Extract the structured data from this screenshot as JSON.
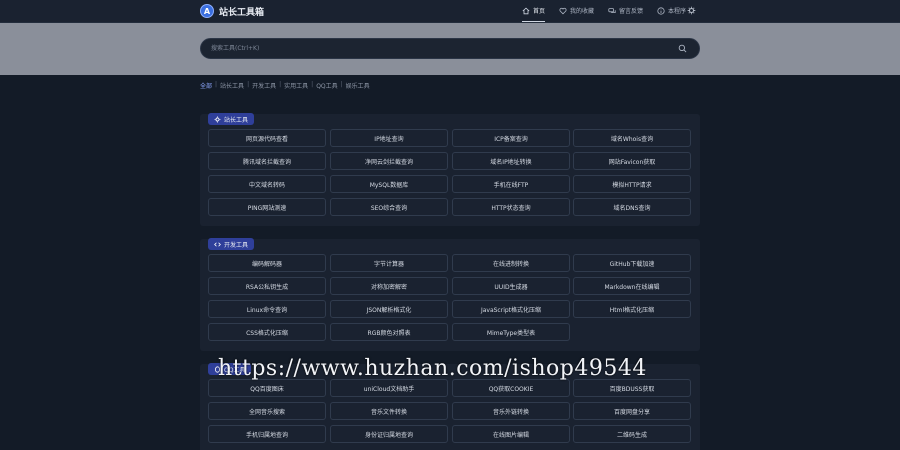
{
  "brand": {
    "name": "站长工具箱",
    "logo_letter": "A"
  },
  "nav": [
    {
      "label": "首页",
      "icon": "home-icon",
      "active": true
    },
    {
      "label": "我的收藏",
      "icon": "heart-icon",
      "active": false
    },
    {
      "label": "留言反馈",
      "icon": "chat-icon",
      "active": false
    },
    {
      "label": "本程序",
      "icon": "info-icon",
      "active": false
    }
  ],
  "search": {
    "placeholder": "搜索工具(Ctrl+K)"
  },
  "breadcrumb": [
    "全部",
    "站长工具",
    "开发工具",
    "实用工具",
    "QQ工具",
    "娱乐工具"
  ],
  "sections": [
    {
      "title": "站长工具",
      "icon": "gear-icon",
      "tools": [
        "网页源代码查看",
        "IP地址查询",
        "ICP备案查询",
        "域名Whois查询",
        "腾讯域名拦截查询",
        "净网云剑拦截查询",
        "域名IP地址转换",
        "网站Favicon获取",
        "中文域名转码",
        "MySQL数据库",
        "手机在线FTP",
        "模拟HTTP请求",
        "PING网站测速",
        "SEO综合查询",
        "HTTP状态查询",
        "域名DNS查询"
      ]
    },
    {
      "title": "开发工具",
      "icon": "code-icon",
      "tools": [
        "编码解码器",
        "字节计算器",
        "在线进制转换",
        "GitHub下载加速",
        "RSA公私钥生成",
        "对称加密解密",
        "UUID生成器",
        "Markdown在线编辑",
        "Linux命令查询",
        "JSON解析格式化",
        "JavaScript格式化压缩",
        "Html格式化压缩",
        "CSS格式化压缩",
        "RGB颜色对照表",
        "MimeType类型表"
      ]
    },
    {
      "title": "QQ工具",
      "icon": "qq-icon",
      "tools": [
        "QQ百度图床",
        "uniCloud文档助手",
        "QQ获取COOKIE",
        "百度BDUSS获取",
        "全网音乐搜索",
        "音乐文件转换",
        "音乐外链转换",
        "百度网盘分享",
        "手机归属地查询",
        "身份证归属地查询",
        "在线图片编辑",
        "二维码生成"
      ]
    }
  ],
  "watermark": "https://www.huzhan.com/ishop49544"
}
